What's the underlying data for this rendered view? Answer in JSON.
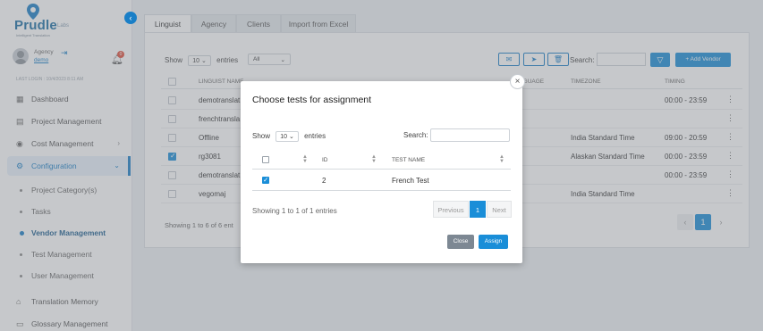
{
  "sidebar": {
    "brand": "Prudle",
    "brand_suffix": "Labs",
    "tagline": "Intelligent Translation",
    "user_role": "Agency",
    "user_name": "demo",
    "notification_count": "0",
    "last_login": "LAST LOGIN : 10/4/2023 8:11 AM",
    "nav": [
      {
        "label": "Dashboard",
        "icon": "dashboard-icon"
      },
      {
        "label": "Project Management",
        "icon": "calendar-icon"
      },
      {
        "label": "Cost Management",
        "icon": "money-icon"
      },
      {
        "label": "Configuration",
        "icon": "gear-icon"
      },
      {
        "label": "Translation Memory",
        "icon": "bank-icon"
      },
      {
        "label": "Glossary Management",
        "icon": "book-icon"
      }
    ],
    "config_sub": [
      "Project Category(s)",
      "Tasks",
      "Vendor Management",
      "Test Management",
      "User Management"
    ]
  },
  "tabs": [
    "Linguist",
    "Agency",
    "Clients",
    "Import from Excel"
  ],
  "main": {
    "show_label": "Show",
    "entries_value": "10",
    "entries_label": "entries",
    "filter_value": "All",
    "search_label": "Search:",
    "add_vendor": "+ Add Vendor",
    "columns": [
      "LINGUIST NAME",
      "LANGUAGE",
      "TIMEZONE",
      "TIMING"
    ],
    "rows": [
      {
        "name": "demotranslat",
        "timezone": "",
        "timing": "00:00 - 23:59",
        "checked": false
      },
      {
        "name": "frenchtransla",
        "timezone": "",
        "timing": "",
        "checked": false
      },
      {
        "name": "Offline",
        "timezone": "India Standard Time",
        "timing": "09:00 - 20:59",
        "checked": false
      },
      {
        "name": "rg3081",
        "timezone": "Alaskan Standard Time",
        "timing": "00:00 - 23:59",
        "checked": true
      },
      {
        "name": "demotranslat",
        "timezone": "",
        "timing": "00:00 - 23:59",
        "checked": false
      },
      {
        "name": "vegomaj",
        "timezone": "India Standard Time",
        "timing": "",
        "checked": false
      }
    ],
    "showing": "Showing 1 to 6 of 6 ent",
    "page": "1"
  },
  "modal": {
    "title": "Choose tests for assignment",
    "show_label": "Show",
    "entries_value": "10",
    "entries_label": "entries",
    "search_label": "Search:",
    "search_value": "",
    "columns": {
      "id": "ID",
      "test_name": "TEST NAME"
    },
    "rows": [
      {
        "id": "2",
        "test_name": "French Test",
        "checked": true
      }
    ],
    "showing": "Showing 1 to 1 of 1 entries",
    "prev": "Previous",
    "page": "1",
    "next": "Next",
    "close_label": "Close",
    "assign_label": "Assign"
  },
  "colors": {
    "accent": "#1a8ed8",
    "close_btn": "#7d8893"
  }
}
